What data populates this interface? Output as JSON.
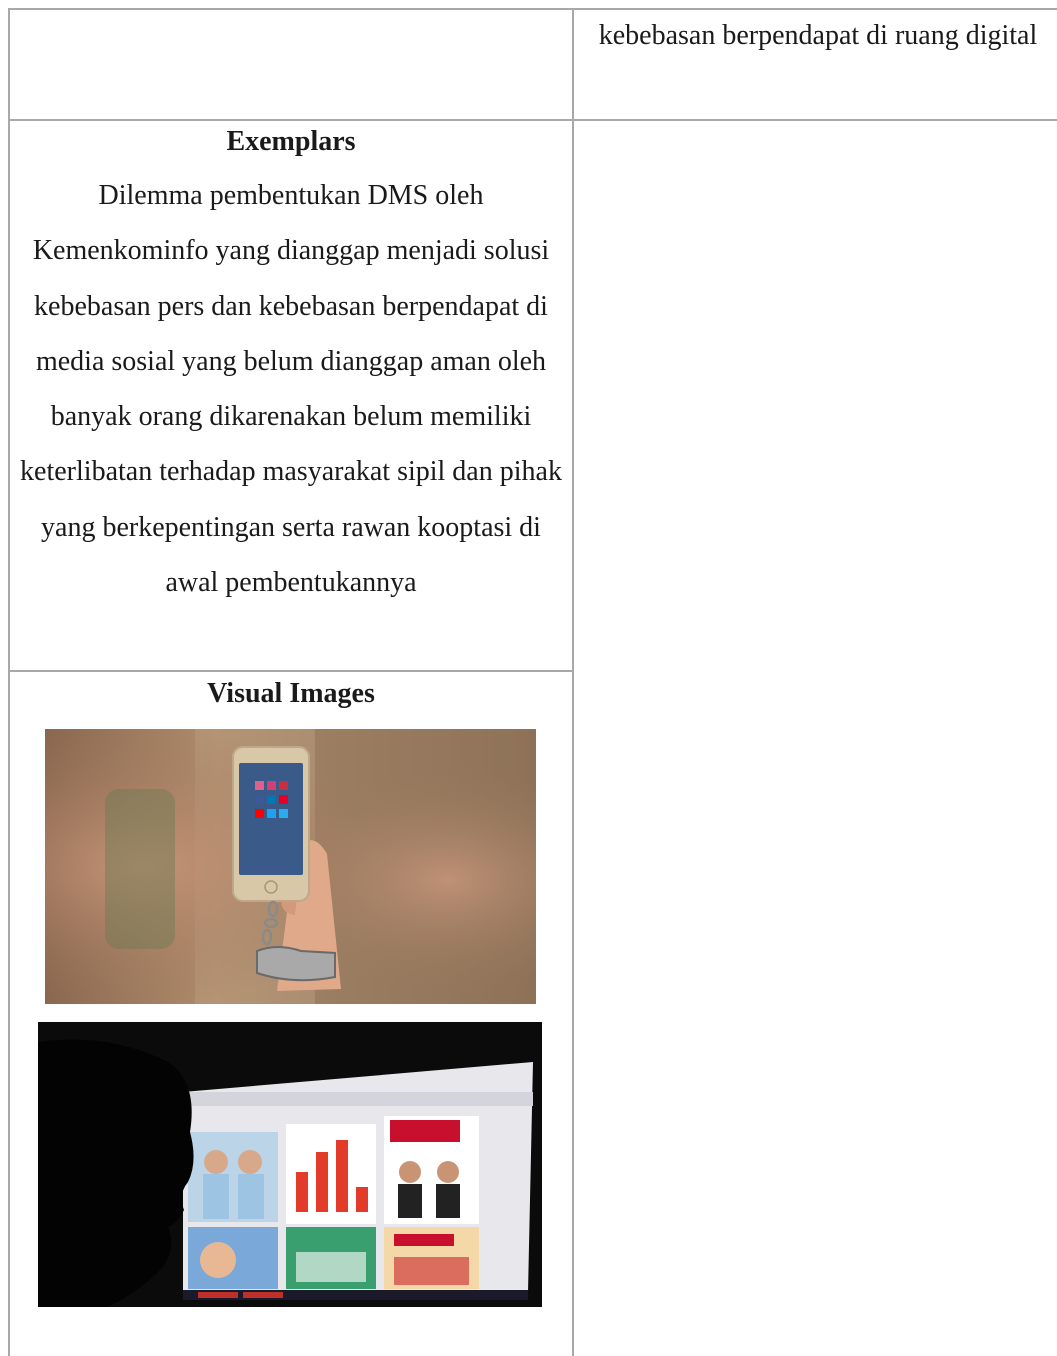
{
  "top_row": {
    "right_cell_text": "kebebasan berpendapat di ruang digital"
  },
  "exemplars": {
    "heading": "Exemplars",
    "body": "Dilemma pembentukan DMS oleh Kemenkominfo yang dianggap menjadi solusi kebebasan pers dan kebebasan berpendapat di media sosial yang belum dianggap aman oleh banyak orang dikarenakan belum memiliki keterlibatan terhadap masyarakat sipil dan pihak yang berkepentingan serta rawan kooptasi di awal pembentukannya"
  },
  "visual_images": {
    "heading": "Visual Images",
    "images": [
      {
        "icon": "handcuffed-smartphone-photo"
      },
      {
        "icon": "monitor-campaign-posts-photo"
      }
    ]
  }
}
